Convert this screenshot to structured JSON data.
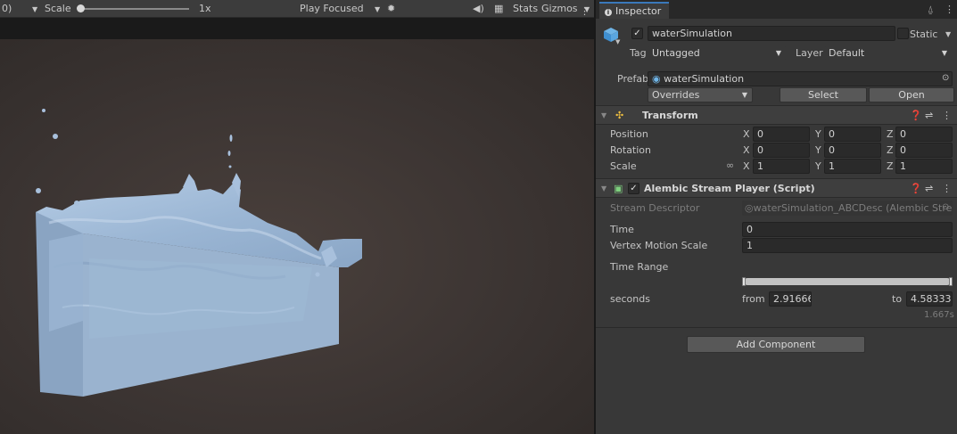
{
  "game_toolbar": {
    "display_suffix": "0)",
    "scale_label": "Scale",
    "scale_value": "1x",
    "play_mode": "Play Focused",
    "stats_label": "Stats",
    "gizmos_label": "Gizmos"
  },
  "inspector": {
    "tab_label": "Inspector",
    "object_name": "waterSimulation",
    "static_label": "Static",
    "tag_label": "Tag",
    "tag_value": "Untagged",
    "layer_label": "Layer",
    "layer_value": "Default",
    "prefab_label": "Prefab",
    "prefab_value": "waterSimulation",
    "overrides_label": "Overrides",
    "select_label": "Select",
    "open_label": "Open"
  },
  "transform": {
    "title": "Transform",
    "position_label": "Position",
    "rotation_label": "Rotation",
    "scale_label": "Scale",
    "axis_x": "X",
    "axis_y": "Y",
    "axis_z": "Z",
    "position": {
      "x": "0",
      "y": "0",
      "z": "0"
    },
    "rotation": {
      "x": "0",
      "y": "0",
      "z": "0"
    },
    "scale": {
      "x": "1",
      "y": "1",
      "z": "1"
    }
  },
  "alembic": {
    "title": "Alembic Stream Player (Script)",
    "stream_descriptor_label": "Stream Descriptor",
    "stream_descriptor_value": "waterSimulation_ABCDesc (Alembic Strea",
    "time_label": "Time",
    "time_value": "0",
    "vertex_motion_label": "Vertex Motion Scale",
    "vertex_motion_value": "1",
    "time_range_label": "Time Range",
    "time_range_fill": 1.0,
    "seconds_label": "seconds",
    "from_label": "from",
    "from_value": "2.91666",
    "to_label": "to",
    "to_value": "4.58333",
    "duration_value": "1.667s"
  },
  "add_component_label": "Add Component",
  "colors": {
    "water": "#9bb6d4",
    "viewport_bg": "#3b3432",
    "inspector_bg": "#383838",
    "accent_tab": "#3a79bb"
  }
}
